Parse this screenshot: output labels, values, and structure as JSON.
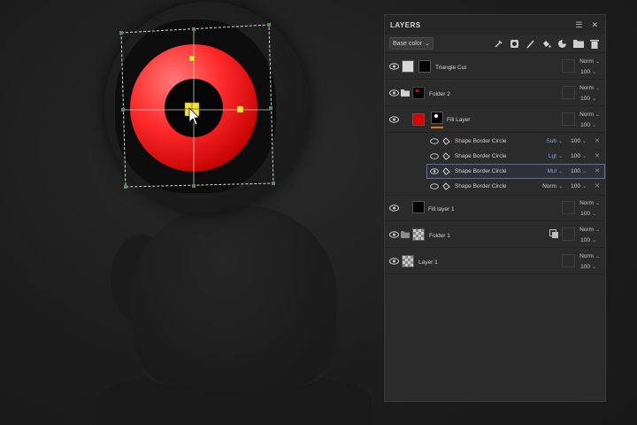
{
  "panel": {
    "title": "LAYERS",
    "header_icons": [
      "menu-icon",
      "close-icon"
    ],
    "toolbar": {
      "blend_select": "Base color",
      "icons": [
        "paint-tool-icon",
        "mask-icon",
        "brush-icon",
        "fill-icon",
        "effect-icon",
        "folder-icon",
        "trash-icon"
      ]
    },
    "layers": [
      {
        "name": "Triangle Cut",
        "blend": "Norm",
        "opacity": "100"
      },
      {
        "name": "Folder 2",
        "blend": "Norm",
        "opacity": "100"
      },
      {
        "name": "Fill Layer",
        "blend": "Norm",
        "opacity": "100"
      },
      {
        "name": "Fill layer 1",
        "blend": "Norm",
        "opacity": "100"
      },
      {
        "name": "Folder 1",
        "blend": "Norm",
        "opacity": "100"
      },
      {
        "name": "Layer 1",
        "blend": "Norm",
        "opacity": "100"
      }
    ],
    "effects": [
      {
        "name": "Shape Border Circle",
        "mode": "Sub",
        "opacity": "100"
      },
      {
        "name": "Shape Border Circle",
        "mode": "Lgt",
        "opacity": "100"
      },
      {
        "name": "Shape Border Circle",
        "mode": "Mul",
        "opacity": "100"
      },
      {
        "name": "Shape Border Circle",
        "mode": "Norm",
        "opacity": "100"
      }
    ]
  },
  "colors": {
    "accent_blue": "#5a8bd6",
    "target_red": "#ff3b3b",
    "handle_yellow": "#f2e23a",
    "layer_highlight": "#d9721f"
  }
}
